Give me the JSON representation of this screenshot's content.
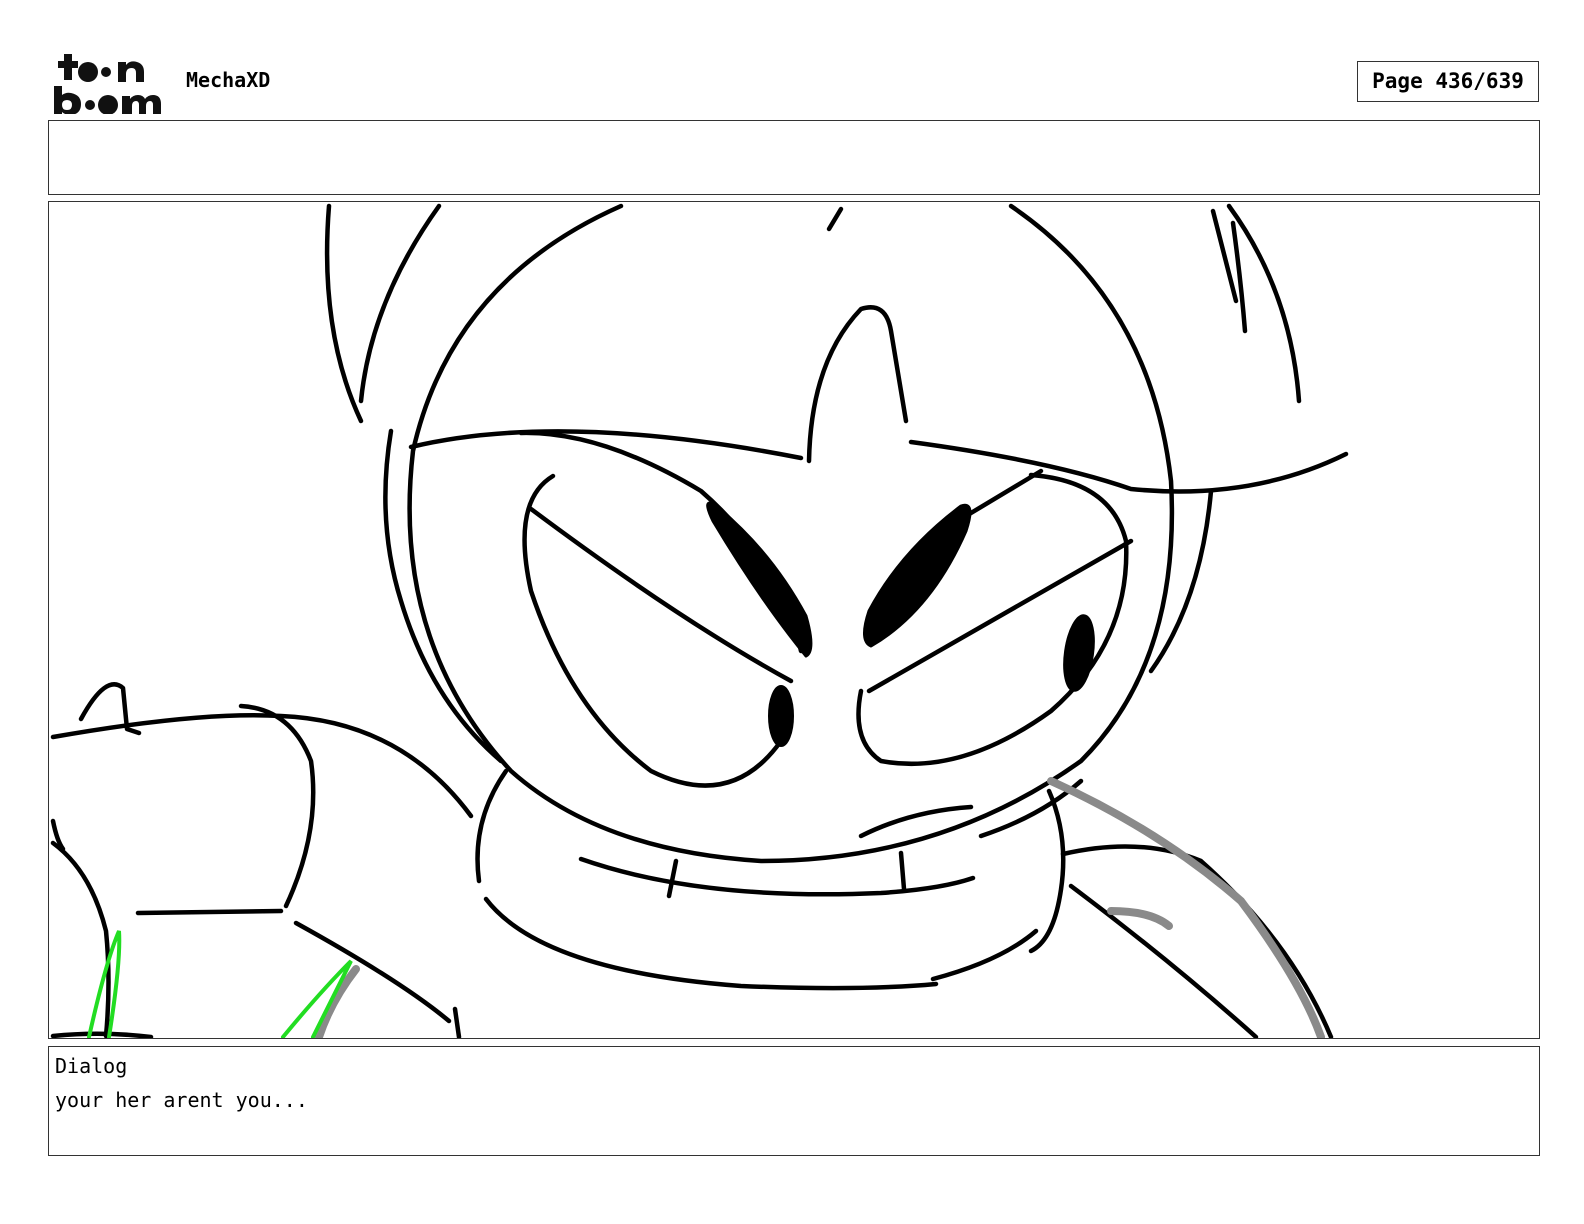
{
  "header": {
    "logo": {
      "line1": "toon",
      "line2": "boom"
    },
    "project_title": "MechaXD",
    "page_label": "Page 436/639"
  },
  "panel": {
    "image": "storyboard-sketch",
    "colors": {
      "line": "#000000",
      "shadow": "#808080",
      "accent": "#22dd22"
    }
  },
  "dialog": {
    "label": "Dialog",
    "text": "your her arent you..."
  }
}
